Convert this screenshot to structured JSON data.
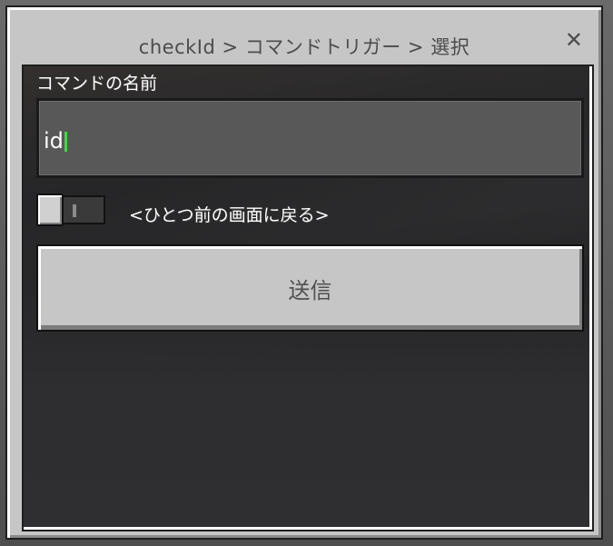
{
  "dialog": {
    "title": "checkId > コマンドトリガー > 選択",
    "close_glyph": "✕"
  },
  "form": {
    "field_label": "コマンドの名前",
    "field_value": "id",
    "toggle_label": "<ひとつ前の画面に戻る>",
    "toggle_on": false,
    "submit_label": "送信"
  },
  "colors": {
    "caret": "#3cdc3c",
    "dialog_bg": "#c6c6c6",
    "panel_bg": "#2f2f31"
  }
}
